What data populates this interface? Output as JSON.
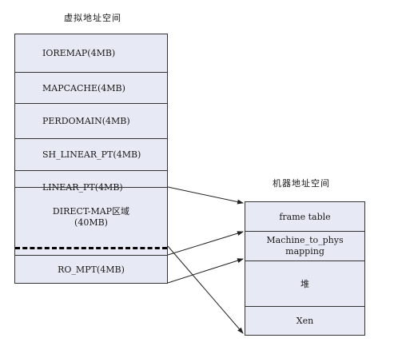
{
  "virtual": {
    "title": "虚拟地址空间",
    "rows": [
      "IOREMAP(4MB)",
      "MAPCACHE(4MB)",
      "PERDOMAIN(4MB)",
      "SH_LINEAR_PT(4MB)",
      "LINEAR_PT(4MB)"
    ],
    "direct_map": [
      "DIRECT-MAP区域",
      "(40MB)"
    ],
    "ro_mpt": "RO_MPT(4MB)"
  },
  "machine": {
    "title": "机器地址空间",
    "rows": [
      "frame table",
      "Machine_to_phys",
      "mapping",
      "堆",
      "Xen"
    ]
  }
}
